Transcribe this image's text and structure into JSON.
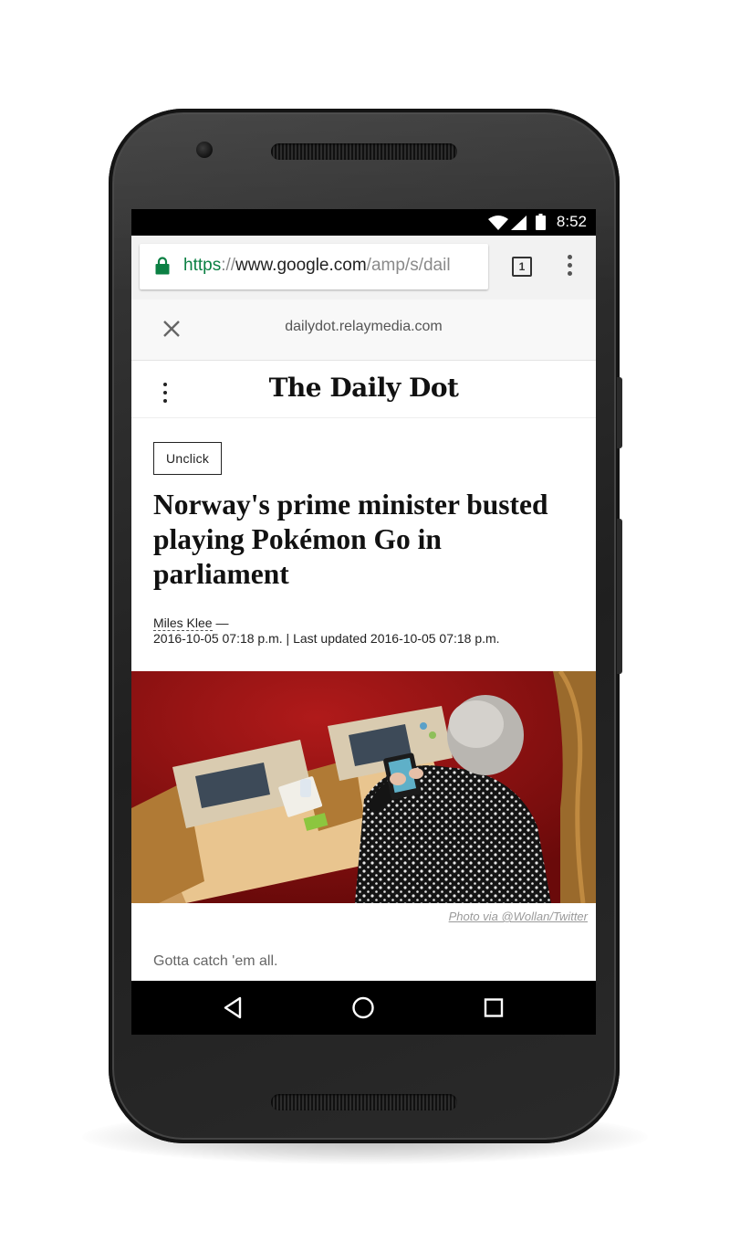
{
  "status_bar": {
    "time": "8:52",
    "icons": [
      "wifi-icon",
      "cell-signal-icon",
      "battery-icon"
    ]
  },
  "browser": {
    "url": {
      "scheme": "https",
      "separator": "://",
      "host": "www.google.com",
      "path": "/amp/s/dail"
    },
    "tab_count": "1",
    "accent_green": "#0b8043"
  },
  "amp_header": {
    "domain": "dailydot.relaymedia.com"
  },
  "site": {
    "logo": "The Daily Dot"
  },
  "article": {
    "tag": "Unclick",
    "headline": "Norway's prime minister busted playing Pokémon Go in parliament",
    "author": "Miles Klee",
    "author_suffix": " —",
    "dateline": "2016-10-05 07:18 p.m. | Last updated 2016-10-05 07:18 p.m.",
    "image_caption": "Photo via @Wollan/Twitter",
    "dek": "Gotta catch 'em all."
  },
  "nav_bar": {
    "buttons": [
      "back-icon",
      "home-icon",
      "recents-icon"
    ]
  }
}
